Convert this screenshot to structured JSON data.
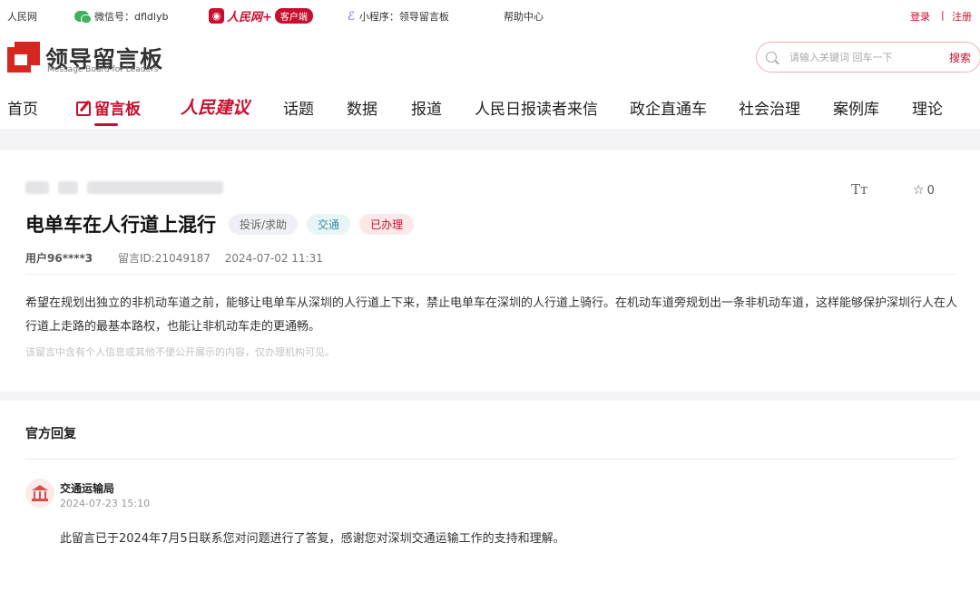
{
  "topbar": {
    "site": "人民网",
    "wechat": "微信号：dfldlyb",
    "app_name": "人民网+",
    "app_tag": "客户端",
    "miniprogram": "小程序：领导留言板",
    "help": "帮助中心",
    "login": "登录",
    "separator": "|",
    "register": "注册"
  },
  "header": {
    "logo_title": "领导留言板",
    "logo_subtitle": "Message Board for Leaders",
    "search_placeholder": "请输入关键词 回车一下",
    "search_button": "搜索"
  },
  "nav": {
    "items": [
      "首页",
      "留言板",
      "人民建议",
      "话题",
      "数据",
      "报道",
      "人民日报读者来信",
      "政企直通车",
      "社会治理",
      "案例库",
      "理论"
    ],
    "active": "留言板"
  },
  "message": {
    "title": "电单车在人行道上混行",
    "tags": [
      "投诉/求助",
      "交通",
      "已办理"
    ],
    "user": "用户96****3",
    "message_id": "留言ID:21049187",
    "datetime": "2024-07-02 11:31",
    "body": "希望在规划出独立的非机动车道之前，能够让电单车从深圳的人行道上下来，禁止电单车在深圳的人行道上骑行。在机动车道旁规划出一条非机动车道，这样能够保护深圳行人在人行道上走路的最基本路权，也能让非机动车走的更通畅。",
    "privacy_note": "该留言中含有个人信息或其他不便公开展示的内容，仅办理机构可见。",
    "font_size_label": "Tт",
    "favorite_count": "0"
  },
  "reply": {
    "heading": "官方回复",
    "department": "交通运输局",
    "date": "2024-07-23 15:10",
    "content": "此留言已于2024年7月5日联系您对问题进行了答复，感谢您对深圳交通运输工作的支持和理解。"
  },
  "colors": {
    "brand_red": "#c8102e",
    "logo_red": "#d7261f",
    "tag_blue": "#3a8fa0"
  }
}
